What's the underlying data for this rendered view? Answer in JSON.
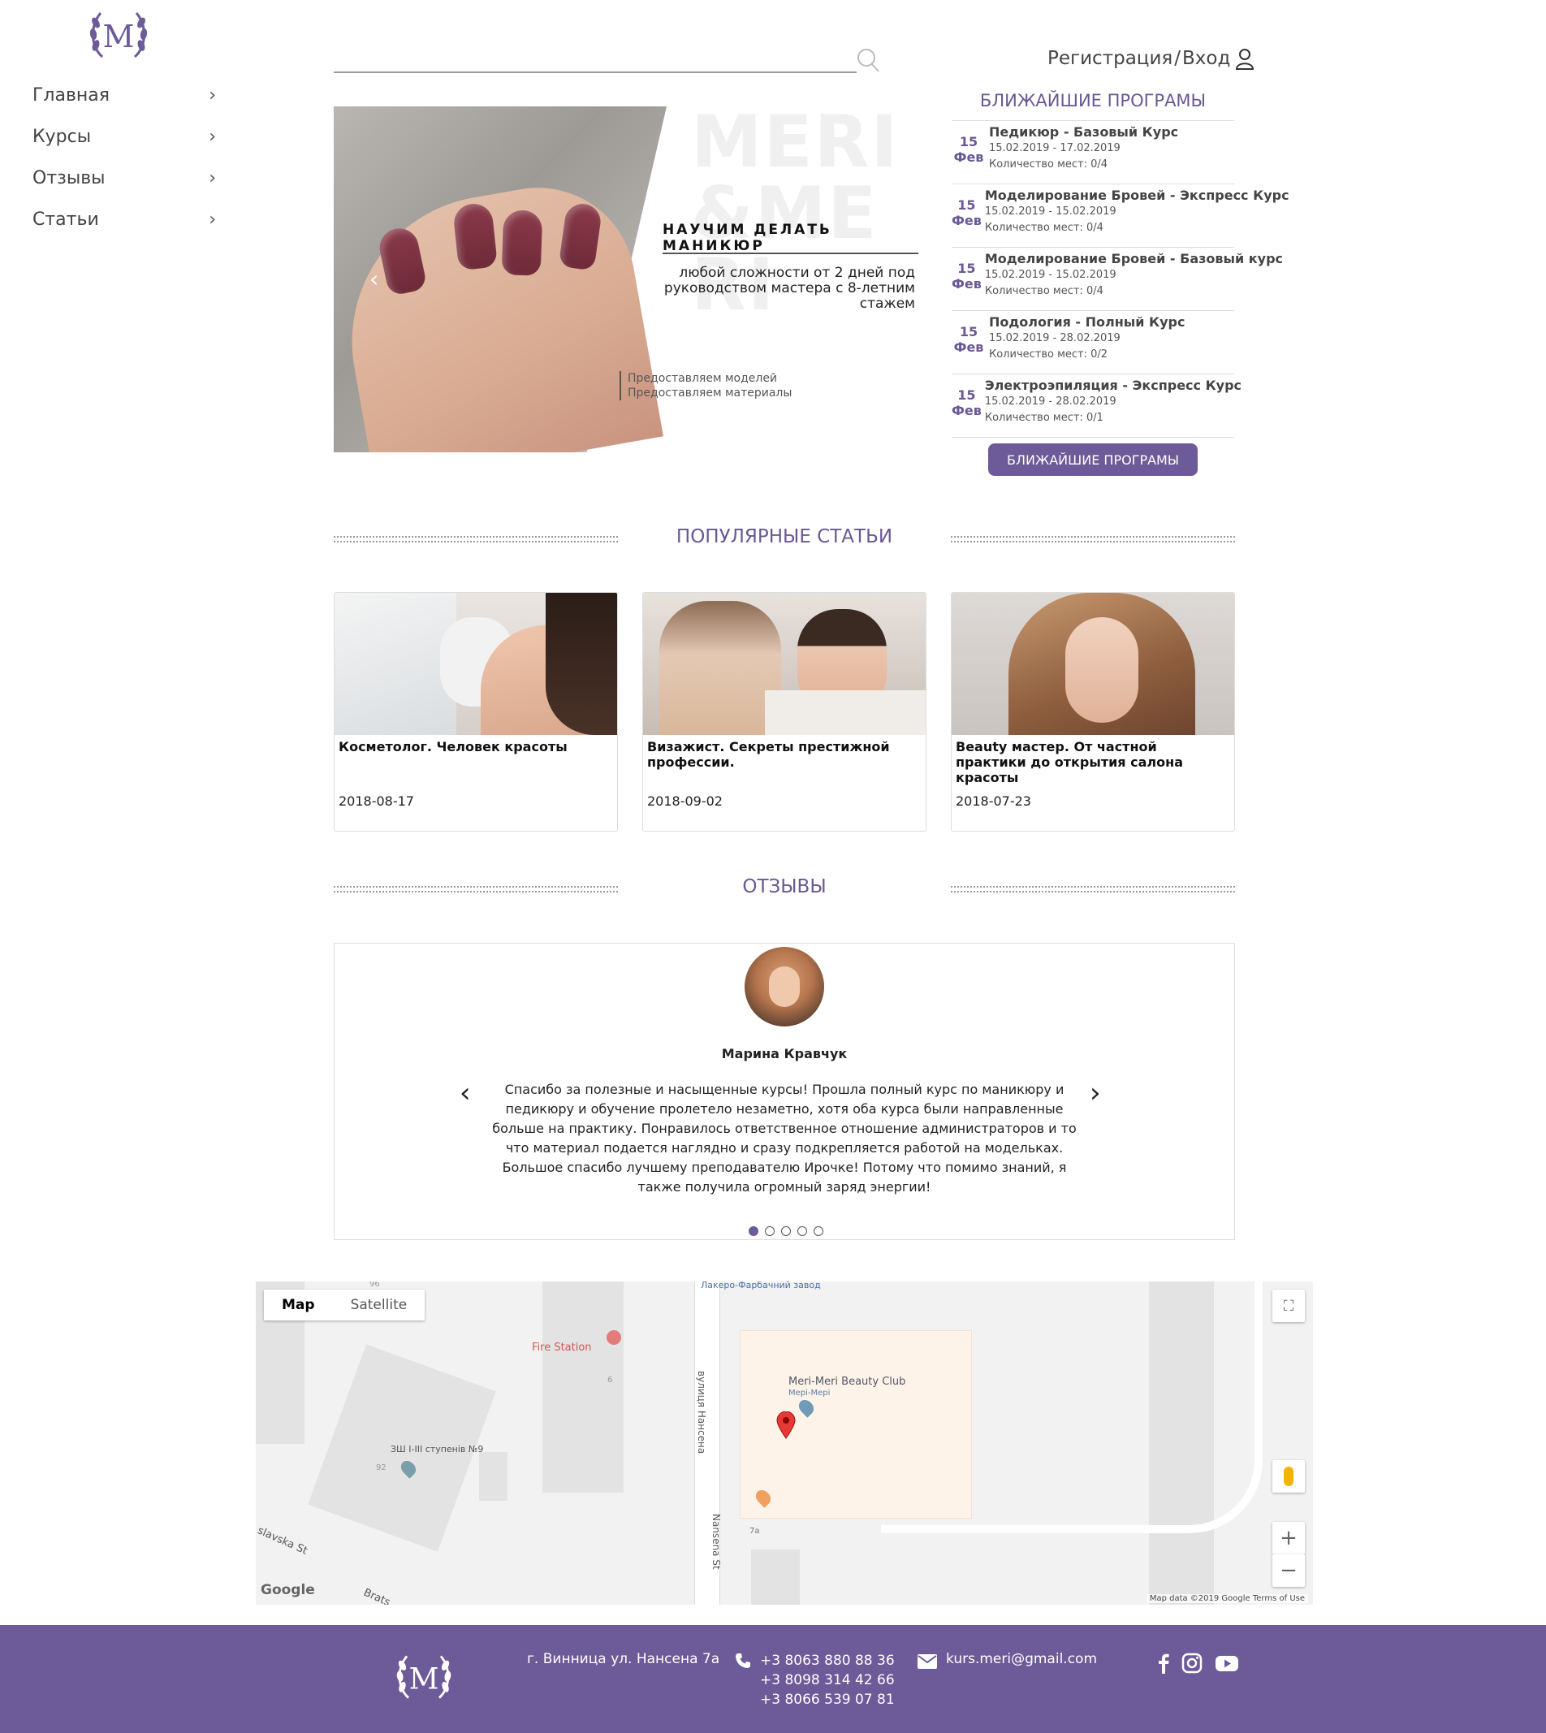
{
  "sidebar": {
    "items": [
      {
        "label": "Главная"
      },
      {
        "label": "Курсы"
      },
      {
        "label": "Отзывы"
      },
      {
        "label": "Статьи"
      }
    ]
  },
  "header": {
    "search_placeholder": "",
    "register_label": "Регистрация",
    "separator": "/",
    "login_label": "Вход"
  },
  "banner": {
    "bg_word": "MERI&MERI",
    "title": "НАУЧИМ ДЕЛАТЬ МАНИКЮР",
    "subtitle": "любой сложности от 2 дней под руководством мастера с 8-летним стажем",
    "note_line1": "Предоставляем моделей",
    "note_line2": "Предоставляем материалы",
    "prev_arrow": "‹"
  },
  "programs": {
    "title": "БЛИЖАЙШИЕ ПРОГРАМЫ",
    "items": [
      {
        "day": "15",
        "month": "Фев",
        "name": "Педикюр - Базовый Курс",
        "dates": "15.02.2019 - 17.02.2019",
        "seats": "Количество мест: 0/4"
      },
      {
        "day": "15",
        "month": "Фев",
        "name": "Моделирование Бровей - Экспресс Курс",
        "dates": "15.02.2019 - 15.02.2019",
        "seats": "Количество мест: 0/4"
      },
      {
        "day": "15",
        "month": "Фев",
        "name": "Моделирование Бровей - Базовый курс",
        "dates": "15.02.2019 - 15.02.2019",
        "seats": "Количество мест: 0/4"
      },
      {
        "day": "15",
        "month": "Фев",
        "name": "Подология - Полный Курс",
        "dates": "15.02.2019 - 28.02.2019",
        "seats": "Количество мест: 0/2"
      },
      {
        "day": "15",
        "month": "Фев",
        "name": "Электроэпиляция - Экспресс Курс",
        "dates": "15.02.2019 - 28.02.2019",
        "seats": "Количество мест: 0/1"
      }
    ],
    "button_label": "БЛИЖАЙШИЕ ПРОГРАМЫ"
  },
  "articles": {
    "heading": "ПОПУЛЯРНЫЕ СТАТЬИ",
    "items": [
      {
        "title": "Косметолог. Человек красоты",
        "date": "2018-08-17"
      },
      {
        "title": "Визажист. Секреты престижной профессии.",
        "date": "2018-09-02"
      },
      {
        "title": "Beauty мастер. От частной практики до открытия салона красоты",
        "date": "2018-07-23"
      }
    ]
  },
  "reviews": {
    "heading": "ОТЗЫВЫ",
    "name": "Марина Кравчук",
    "text": "Спасибо за полезные и насыщенные курсы! Прошла полный курс по маникюру и педикюру и обучение пролетело незаметно, хотя оба курса были направленные больше на практику. Понравилось ответственное отношение администраторов и то что материал подается наглядно и сразу подкрепляется работой на модельках. Большое спасибо лучшему преподавателю Ирочке! Потому что помимо знаний, я также получила огромный заряд энергии!",
    "prev": "‹",
    "next": "›",
    "slide_count": 5,
    "active_slide": 1
  },
  "map": {
    "tab_map": "Map",
    "tab_satellite": "Satellite",
    "label_factory": "Лакеро-Фарбачний завод",
    "label_fire": "Fire Station",
    "label_street_ua": "вулиця Нансена",
    "label_street_en": "Nansena St",
    "label_club": "Meri-Meri Beauty Club",
    "label_club_sub": "Мері-Мері",
    "label_school": "ЗШ I-III ступенів №9",
    "label_92": "92",
    "label_6": "6",
    "label_7a": "7a",
    "label_96": "96",
    "label_slavska": "slavska St",
    "label_brat": "Brats",
    "google": "Google",
    "credit": "Map data ©2019 Google   Terms of Use",
    "zoom_in": "+",
    "zoom_out": "−"
  },
  "footer": {
    "address": "г. Винница ул. Нансена 7а",
    "phones": [
      "+3 8063 880 88 36",
      "+3 8098 314 42 66",
      "+3 8066 539 07 81"
    ],
    "email": "kurs.meri@gmail.com"
  },
  "colors": {
    "brand": "#6d5a98",
    "heading": "#6a5894",
    "nail": "#7a3242"
  },
  "icons": [
    "logo-icon",
    "chevron-right-icon",
    "search-icon",
    "user-icon",
    "phone-icon",
    "mail-icon",
    "facebook-icon",
    "instagram-icon",
    "youtube-icon",
    "map-pin-icon",
    "fullscreen-icon",
    "pegman-icon"
  ]
}
